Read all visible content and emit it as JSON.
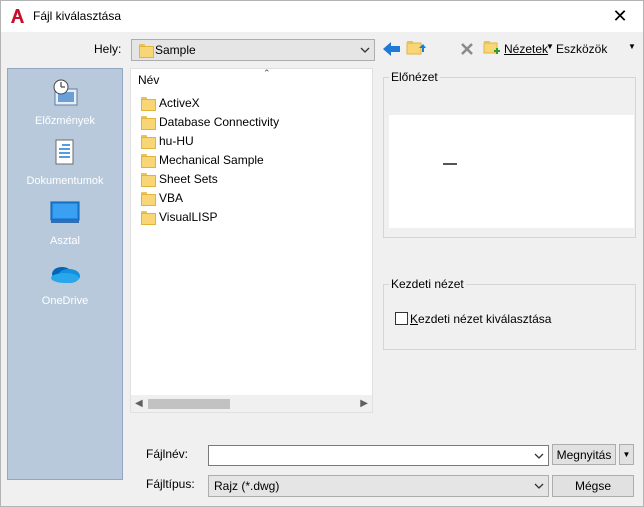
{
  "window": {
    "title": "Fájl kiválasztása",
    "close_glyph": "✕"
  },
  "location": {
    "label": "Hely:",
    "value": "Sample"
  },
  "toolbar": {
    "views_label": "Nézetek",
    "tools_label": "Eszközök"
  },
  "sidebar": {
    "items": [
      {
        "label": "Előzmények",
        "icon": "history-icon"
      },
      {
        "label": "Dokumentumok",
        "icon": "documents-icon"
      },
      {
        "label": "Asztal",
        "icon": "desktop-icon"
      },
      {
        "label": "OneDrive",
        "icon": "onedrive-icon"
      }
    ]
  },
  "filelist": {
    "column_header": "Név",
    "items": [
      "ActiveX",
      "Database Connectivity",
      "hu-HU",
      "Mechanical Sample",
      "Sheet Sets",
      "VBA",
      "VisualLISP"
    ]
  },
  "preview": {
    "title": "Előnézet"
  },
  "initial_view": {
    "title": "Kezdeti nézet",
    "checkbox_label": "Kezdeti nézet kiválasztása",
    "checked": false
  },
  "filename": {
    "label": "Fájlnév:",
    "value": ""
  },
  "filetype": {
    "label": "Fájltípus:",
    "value": "Rajz (*.dwg)"
  },
  "buttons": {
    "open": "Megnyitás",
    "cancel": "Mégse"
  },
  "colors": {
    "sidebar_bg": "#b8c9dc",
    "accent_blue": "#0078d7",
    "folder_yellow": "#f8d675",
    "autocad_red": "#c8102e"
  }
}
